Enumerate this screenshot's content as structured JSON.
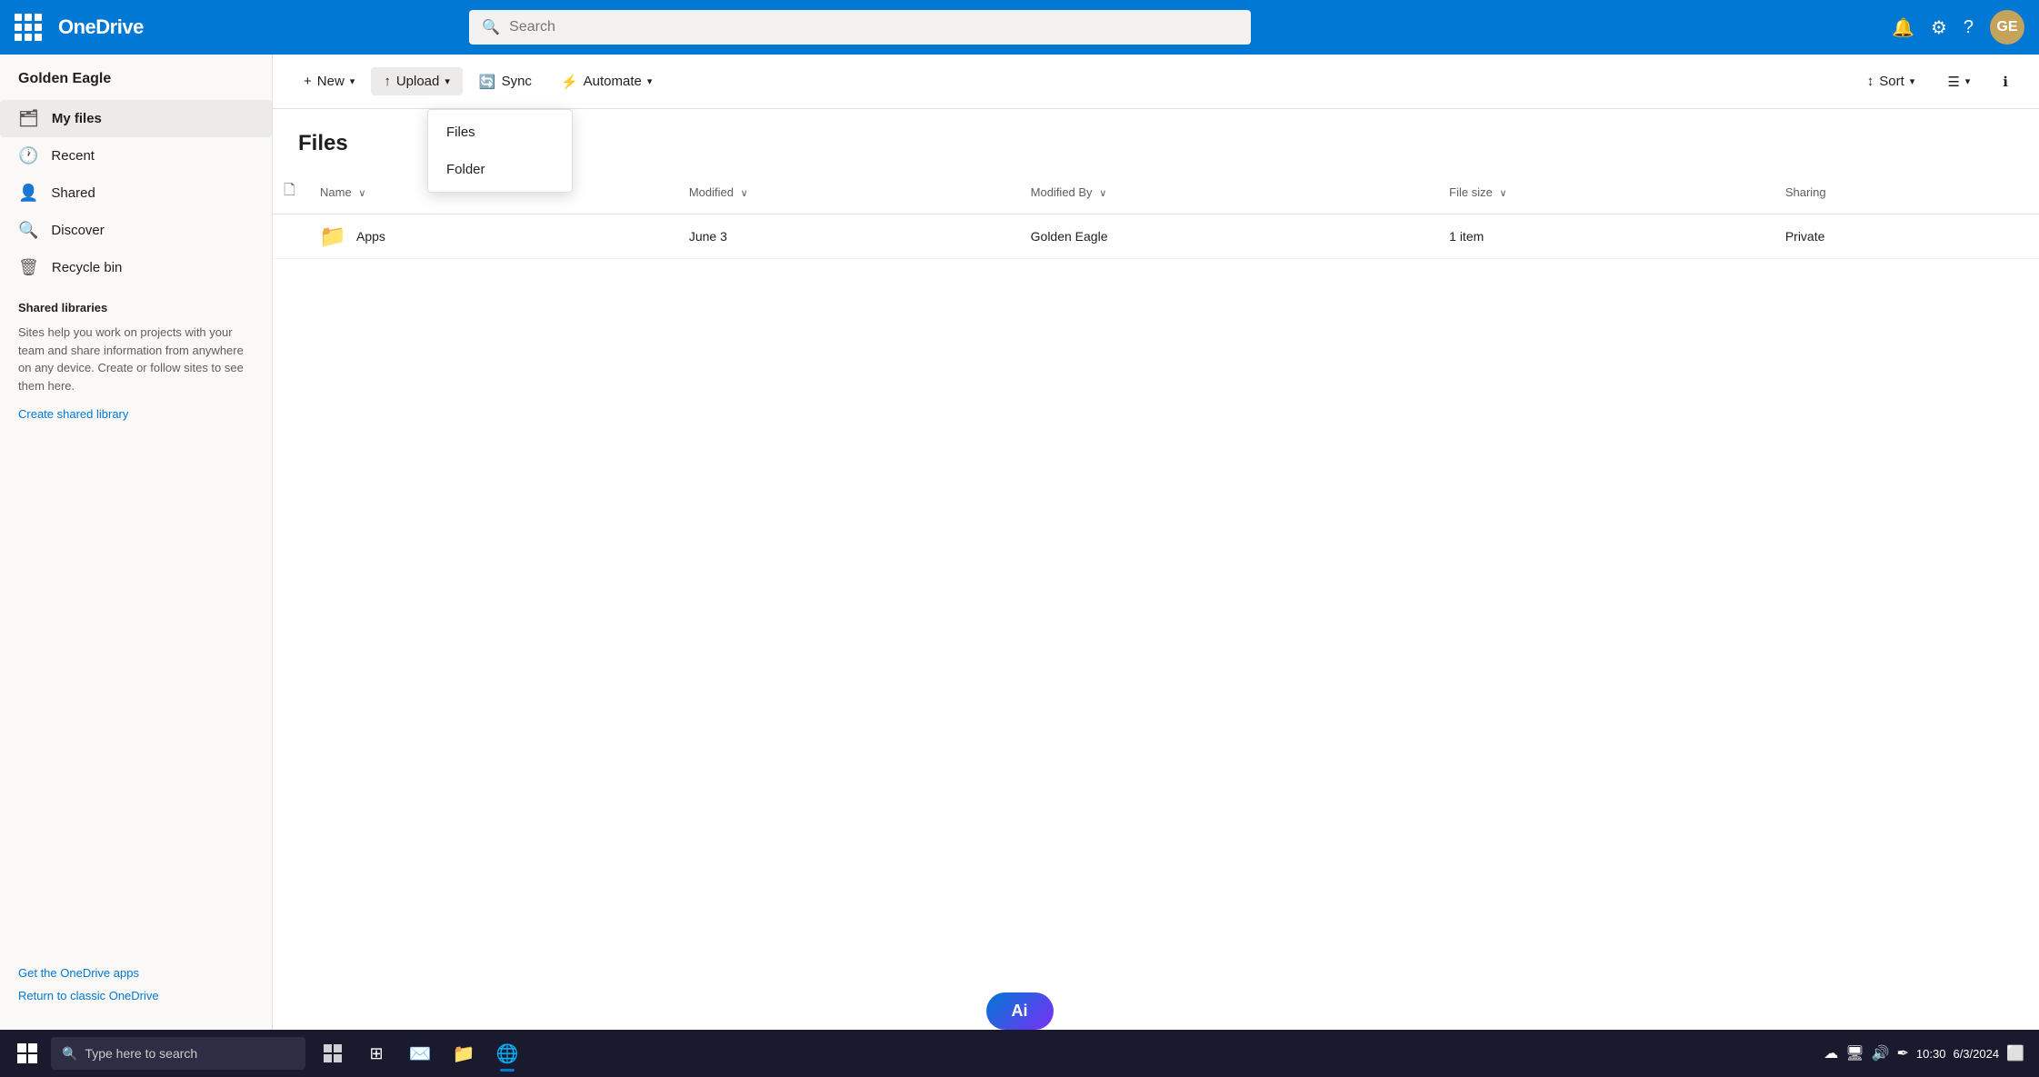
{
  "app": {
    "name": "OneDrive"
  },
  "topnav": {
    "search_placeholder": "Search",
    "bell_icon": "🔔",
    "settings_icon": "⚙",
    "help_icon": "?",
    "avatar_label": "GE"
  },
  "sidebar": {
    "user": "Golden Eagle",
    "items": [
      {
        "id": "my-files",
        "label": "My files",
        "icon": "🗂",
        "active": true
      },
      {
        "id": "recent",
        "label": "Recent",
        "icon": "🕐",
        "active": false
      },
      {
        "id": "shared",
        "label": "Shared",
        "icon": "👤",
        "active": false
      },
      {
        "id": "discover",
        "label": "Discover",
        "icon": "🔍",
        "active": false
      },
      {
        "id": "recycle-bin",
        "label": "Recycle bin",
        "icon": "🗑",
        "active": false
      }
    ],
    "shared_libraries_title": "Shared libraries",
    "shared_libraries_desc": "Sites help you work on projects with your team and share information from anywhere on any device. Create or follow sites to see them here.",
    "create_shared_library_label": "Create shared library",
    "get_apps_label": "Get the OneDrive apps",
    "return_classic_label": "Return to classic OneDrive"
  },
  "toolbar": {
    "new_label": "New",
    "upload_label": "Upload",
    "sync_label": "Sync",
    "automate_label": "Automate",
    "sort_label": "Sort",
    "upload_dropdown": {
      "items": [
        {
          "id": "files",
          "label": "Files"
        },
        {
          "id": "folder",
          "label": "Folder"
        }
      ]
    }
  },
  "main": {
    "title": "Files",
    "columns": [
      {
        "id": "name",
        "label": "Name",
        "sortable": true
      },
      {
        "id": "modified",
        "label": "Modified",
        "sortable": true
      },
      {
        "id": "modified_by",
        "label": "Modified By",
        "sortable": true
      },
      {
        "id": "file_size",
        "label": "File size",
        "sortable": true
      },
      {
        "id": "sharing",
        "label": "Sharing",
        "sortable": false
      }
    ],
    "rows": [
      {
        "name": "Apps",
        "modified": "June 3",
        "modified_by": "Golden Eagle",
        "file_size": "1 item",
        "sharing": "Private",
        "type": "folder"
      }
    ]
  },
  "taskbar": {
    "search_placeholder": "Type here to search",
    "apps": [
      {
        "id": "task-view",
        "icon": "⊞",
        "active": false
      },
      {
        "id": "widgets",
        "icon": "⊟",
        "active": false
      },
      {
        "id": "mail",
        "icon": "✉",
        "active": false
      },
      {
        "id": "explorer",
        "icon": "📁",
        "active": false
      },
      {
        "id": "edge",
        "icon": "🌐",
        "active": true
      }
    ],
    "right_icons": [
      "☁",
      "🖥",
      "🔊",
      "🔧"
    ],
    "time": "10:30",
    "date": "6/3/2024"
  },
  "ai_button": {
    "label": "Ai"
  }
}
